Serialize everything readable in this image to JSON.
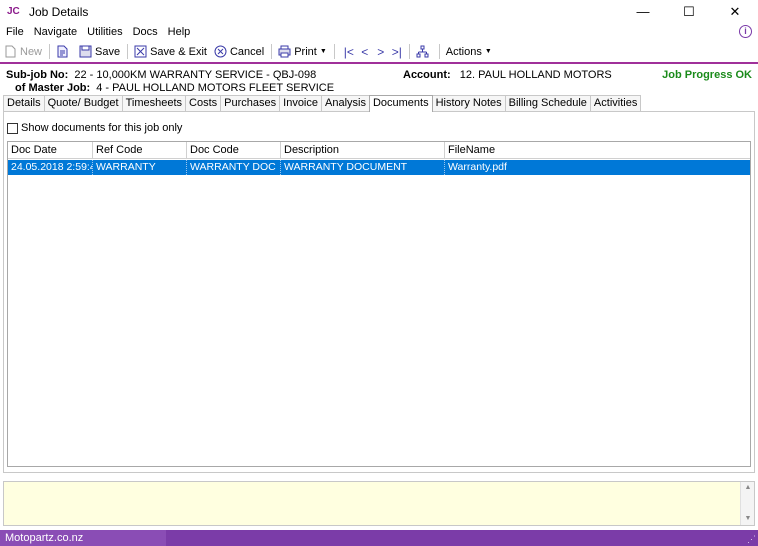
{
  "window": {
    "app_icon": "JC",
    "title": "Job Details",
    "minimize": "—",
    "maximize": "☐",
    "close": "✕"
  },
  "menu": [
    "File",
    "Navigate",
    "Utilities",
    "Docs",
    "Help"
  ],
  "toolbar": {
    "new": "New",
    "save": "Save",
    "save_exit": "Save & Exit",
    "cancel": "Cancel",
    "print": "Print",
    "actions": "Actions"
  },
  "job": {
    "subjob_label": "Sub-job No:",
    "subjob_value": "22 - 10,000KM WARRANTY SERVICE - QBJ-098",
    "master_label": "of Master Job:",
    "master_value": "4 - PAUL HOLLAND MOTORS FLEET SERVICE",
    "account_label": "Account:",
    "account_value": "12. PAUL HOLLAND MOTORS",
    "progress": "Job Progress OK"
  },
  "tabs": [
    "Details",
    "Quote/ Budget",
    "Timesheets",
    "Costs",
    "Purchases",
    "Invoice",
    "Analysis",
    "Documents",
    "History Notes",
    "Billing Schedule",
    "Activities"
  ],
  "active_tab": "Documents",
  "documents": {
    "show_only_label": "Show documents for this job only",
    "columns": [
      "Doc Date",
      "Ref Code",
      "Doc Code",
      "Description",
      "FileName"
    ],
    "rows": [
      [
        "24.05.2018 2:59:45 ...",
        "WARRANTY",
        "WARRANTY DOC",
        "WARRANTY DOCUMENT",
        "Warranty.pdf"
      ]
    ]
  },
  "status": {
    "company": "Motopartz.co.nz"
  },
  "colors": {
    "accent": "#a0309a",
    "selection": "#0078d7",
    "status_bar": "#7b3ca8",
    "progress_ok": "#1a8a1a",
    "notes_bg": "#ffffe0"
  }
}
